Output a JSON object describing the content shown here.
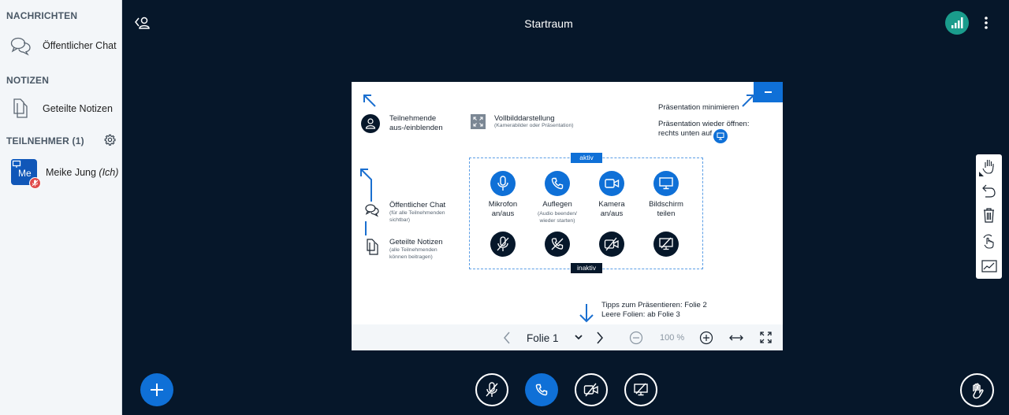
{
  "sidebar": {
    "messages_title": "NACHRICHTEN",
    "public_chat": "Öffentlicher Chat",
    "notes_title": "NOTIZEN",
    "shared_notes": "Geteilte Notizen",
    "participants_title": "TEILNEHMER (1)",
    "user": {
      "initials": "Me",
      "name": "Meike Jung",
      "self_tag": "(Ich)"
    }
  },
  "header": {
    "title": "Startraum"
  },
  "slide": {
    "toggle_users": [
      "Teilnehmende",
      "aus-/einblenden"
    ],
    "fullscreen_title": "Vollbilddarstellung",
    "fullscreen_sub": "(Kamerabilder oder Präsentation)",
    "minimize": "Präsentation minimieren",
    "reopen": [
      "Präsentation wieder öffnen:",
      "rechts unten auf"
    ],
    "active": "aktiv",
    "inactive": "inaktiv",
    "public_chat_title": "Öffentlicher Chat",
    "public_chat_sub": [
      "(für alle Teilnehmenden",
      "sichtbar)"
    ],
    "shared_notes_title": "Geteilte Notizen",
    "shared_notes_sub": [
      "(alle Teilnehmenden",
      "können beitragen)"
    ],
    "controls": [
      {
        "label": [
          "Mikrofon",
          "an/aus"
        ],
        "sub": []
      },
      {
        "label": [
          "Auflegen"
        ],
        "sub": [
          "(Audio beenden/",
          "wieder starten)"
        ]
      },
      {
        "label": [
          "Kamera",
          "an/aus"
        ],
        "sub": []
      },
      {
        "label": [
          "Bildschirm",
          "teilen"
        ],
        "sub": []
      }
    ],
    "tips": [
      "Tipps zum Präsentieren: Folie 2",
      "Leere Folien: ab Folie 3"
    ]
  },
  "slide_controls": {
    "current": "Folie 1",
    "zoom": "100 %"
  },
  "colors": {
    "accent": "#0f70d7",
    "background": "#06172a",
    "connection": "#1a9c8c",
    "mute": "#e04b4b"
  },
  "icons": [
    "chat-icon",
    "notes-icon",
    "gear-icon",
    "avatar",
    "user-list-icon",
    "connection-icon",
    "kebab-icon",
    "plus-icon",
    "mic-off-icon",
    "phone-icon",
    "camera-off-icon",
    "screen-off-icon",
    "hand-icon",
    "undo-icon",
    "trash-icon",
    "pointer-icon",
    "line-icon"
  ]
}
